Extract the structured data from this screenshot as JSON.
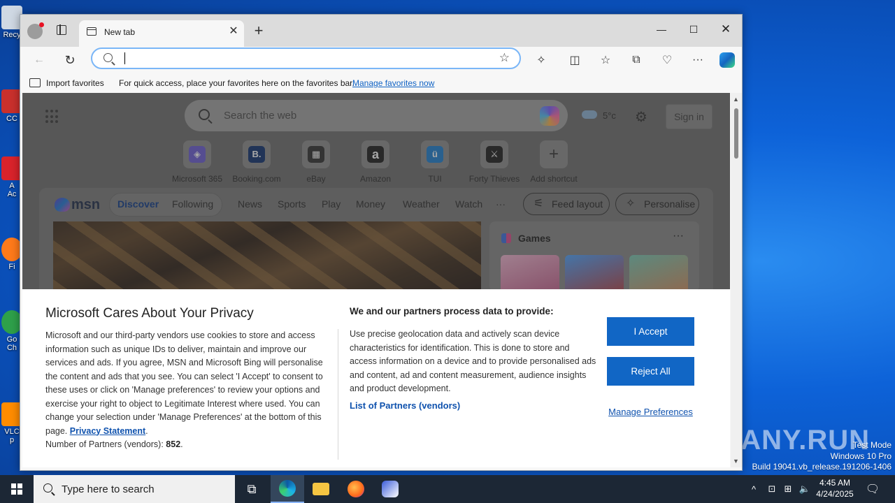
{
  "desktop": {
    "icons": [
      {
        "label": "Recy",
        "color": "#cfd8e3"
      },
      {
        "label": "CC",
        "color": "#c9302c"
      },
      {
        "label": "A\nAc",
        "color": "#d9232b"
      },
      {
        "label": "Fi",
        "color": "#ff7a1a"
      },
      {
        "label": "Go\nCh",
        "color": "#2ea04a"
      },
      {
        "label": "VLC\np",
        "color": "#ff8c00"
      }
    ],
    "watermark": "ANY.RUN",
    "wininfo": [
      "Test Mode",
      "Windows 10 Pro",
      "Build 19041.vb_release.191206-1406"
    ]
  },
  "browser": {
    "tab_title": "New tab",
    "address": {
      "value": "",
      "placeholder": ""
    },
    "favorites_bar": {
      "import_label": "Import favorites",
      "hint": "For quick access, place your favorites here on the favorites bar.",
      "manage_link": "Manage favorites now"
    }
  },
  "newtab": {
    "search_placeholder": "Search the web",
    "weather_temp": "5°c",
    "signin_label": "Sign in",
    "shortcuts": [
      {
        "label": "Microsoft 365",
        "glyph": "◈",
        "color": "#6b5bd6"
      },
      {
        "label": "Booking.com",
        "glyph": "B.",
        "color": "#0b2f6e"
      },
      {
        "label": "eBay",
        "glyph": "▦",
        "color": "#2f2f2f"
      },
      {
        "label": "Amazon",
        "glyph": "a",
        "color": "#1a1a1a"
      },
      {
        "label": "TUI",
        "glyph": "ü",
        "color": "#1a7fd1"
      },
      {
        "label": "Forty Thieves",
        "glyph": "⚔",
        "color": "#1a1a1a"
      },
      {
        "label": "Add shortcut",
        "glyph": "+",
        "color": "#7a7a7a"
      }
    ],
    "msn": {
      "logo": "msn",
      "pill_discover": "Discover",
      "pill_following": "Following",
      "nav": [
        "News",
        "Sports",
        "Play",
        "Money",
        "Weather",
        "Watch",
        "···"
      ],
      "feed_layout": "Feed layout",
      "personalise": "Personalise",
      "games_title": "Games",
      "games_more": "···"
    }
  },
  "privacy": {
    "title": "Microsoft Cares About Your Privacy",
    "body": "Microsoft and our third-party vendors use cookies to store and access information such as unique IDs to deliver, maintain and improve our services and ads. If you agree, MSN and Microsoft Bing will personalise the content and ads that you see. You can select 'I Accept' to consent to these uses or click on 'Manage preferences' to review your options and exercise your right to object to Legitimate Interest where used.  You can change your selection under 'Manage Preferences' at the bottom of this page.",
    "privacy_link": "Privacy Statement",
    "partners_label": "Number of Partners (vendors):",
    "partners_count": "852",
    "right_title": "We and our partners process data to provide:",
    "right_body": "Use precise geolocation data and actively scan device characteristics for identification. This is done to store and access information on a device and to provide personalised ads and content, ad and content measurement, audience insights and product development.",
    "partners_link": "List of Partners (vendors)",
    "accept": "I Accept",
    "reject": "Reject All",
    "manage": "Manage Preferences"
  },
  "taskbar": {
    "search_placeholder": "Type here to search",
    "time": "4:45 AM",
    "date": "4/24/2025"
  }
}
